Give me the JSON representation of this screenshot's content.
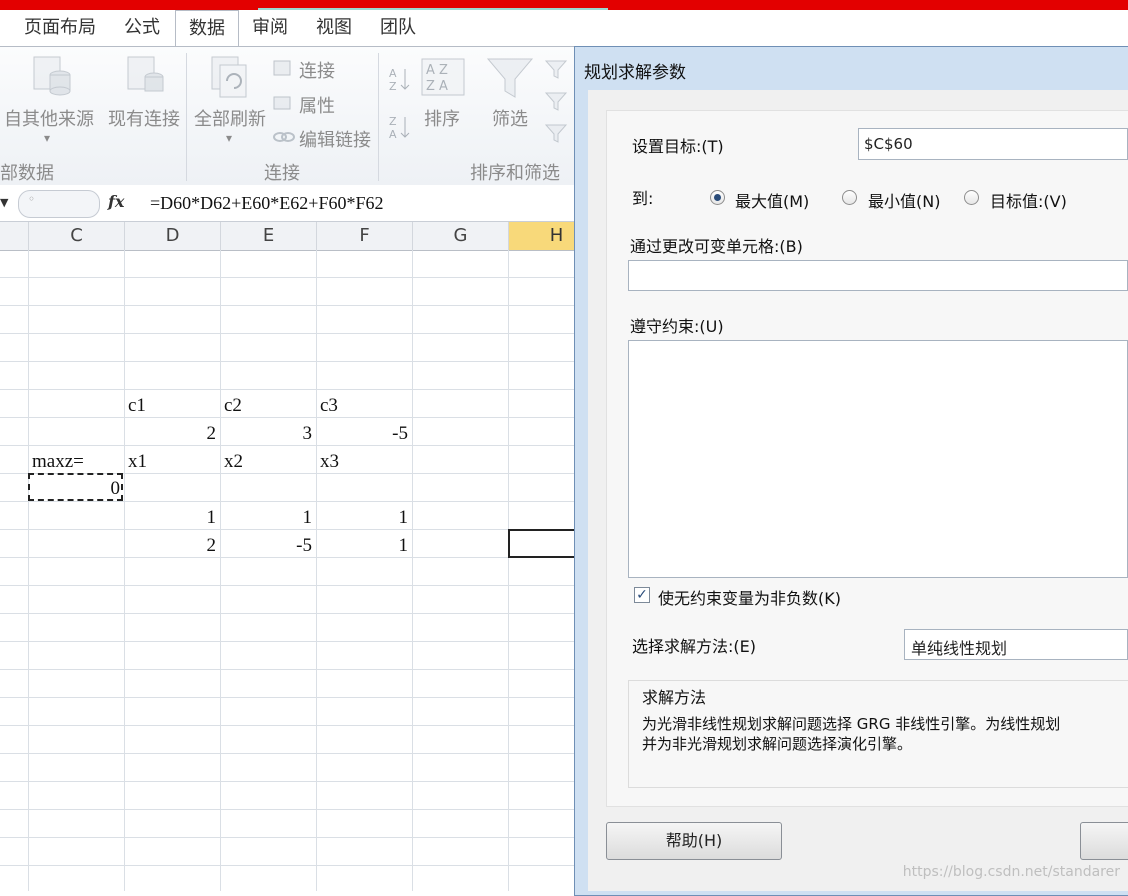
{
  "tabs": [
    "页面布局",
    "公式",
    "数据",
    "审阅",
    "视图",
    "团队"
  ],
  "active_tab": "数据",
  "ribbon": {
    "get_external": {
      "other_sources": "自其他来源",
      "existing_conn": "现有连接",
      "group_label": "部数据"
    },
    "connections": {
      "refresh_all": "全部刷新",
      "connections": "连接",
      "properties": "属性",
      "edit_links": "编辑链接",
      "group_label": "连接"
    },
    "sort_filter": {
      "sort": "排序",
      "filter": "筛选",
      "group_label": "排序和筛选"
    }
  },
  "formula_bar": {
    "fx": "fx",
    "formula": "=D60*D62+E60*E62+F60*F62"
  },
  "columns": [
    "C",
    "D",
    "E",
    "F",
    "G",
    "H"
  ],
  "cells": {
    "c1": "c1",
    "c2": "c2",
    "c3": "c3",
    "v_c1": "2",
    "v_c2": "3",
    "v_c3": "-5",
    "maxz": "maxz=",
    "x1": "x1",
    "x2": "x2",
    "x3": "x3",
    "result": "0",
    "r1_d": "1",
    "r1_e": "1",
    "r1_f": "1",
    "r2_d": "2",
    "r2_e": "-5",
    "r2_f": "1"
  },
  "dialog": {
    "title": "规划求解参数",
    "set_objective_label": "设置目标:(T)",
    "set_objective_value": "$C$60",
    "to_label": "到:",
    "radio_max": "最大值(M)",
    "radio_min": "最小值(N)",
    "radio_value": "目标值:(V)",
    "selected": "max",
    "changing_cells_label": "通过更改可变单元格:(B)",
    "changing_cells_value": "",
    "constraints_label": "遵守约束:(U)",
    "nonneg_label": "使无约束变量为非负数(K)",
    "nonneg_checked": true,
    "method_label": "选择求解方法:(E)",
    "method_value": "单纯线性规划",
    "method_group_title": "求解方法",
    "method_desc_line1": "为光滑非线性规划求解问题选择 GRG 非线性引擎。为线性规划",
    "method_desc_line2": "并为非光滑规划求解问题选择演化引擎。",
    "help_button": "帮助(H)"
  },
  "watermark": "https://blog.csdn.net/standarer"
}
